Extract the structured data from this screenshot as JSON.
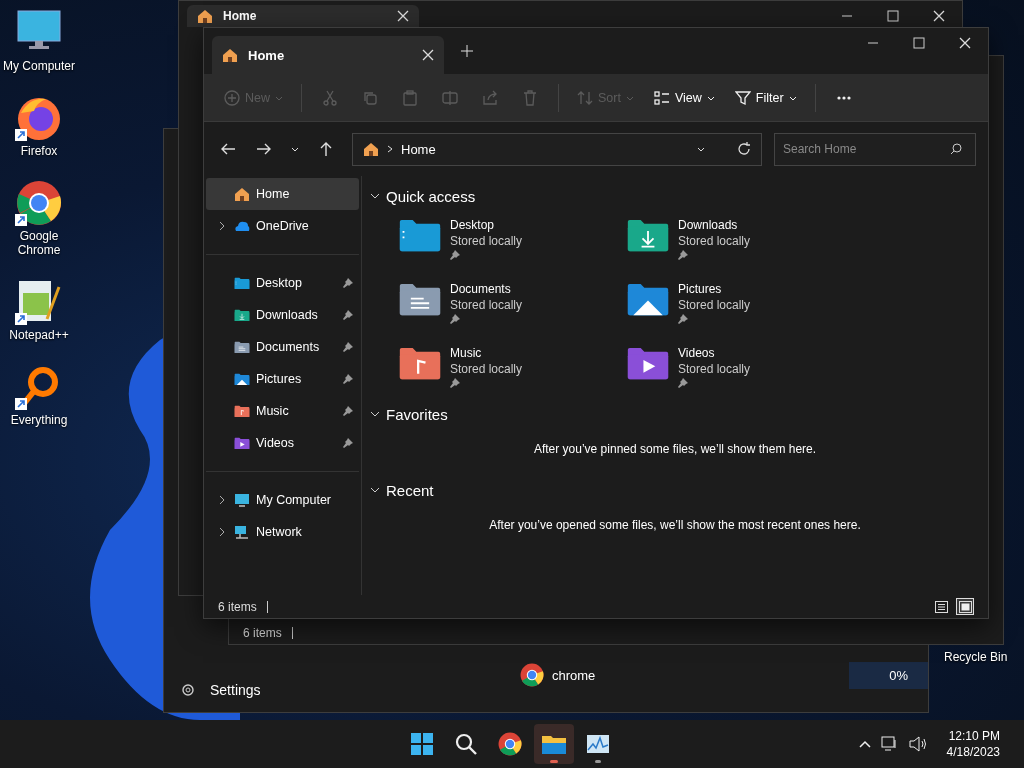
{
  "desktop_icons": [
    {
      "kind": "computer",
      "label": "My Computer",
      "shortcut": false
    },
    {
      "kind": "firefox",
      "label": "Firefox",
      "shortcut": true
    },
    {
      "kind": "chrome",
      "label": "Google Chrome",
      "shortcut": true
    },
    {
      "kind": "notepad",
      "label": "Notepad++",
      "shortcut": true
    },
    {
      "kind": "everything",
      "label": "Everything",
      "shortcut": true
    }
  ],
  "recycle_bin": {
    "label": "Recycle Bin"
  },
  "task_window": {
    "settings": "Settings",
    "processes": [
      {
        "name": "chrome",
        "value": "0%"
      }
    ]
  },
  "back_explorer": {
    "tab": "Home"
  },
  "second_explorer": {
    "status": "6 items"
  },
  "explorer": {
    "tab": {
      "label": "Home",
      "selected": true
    },
    "toolbar": [
      {
        "kind": "new",
        "label": "New",
        "disabled": true
      },
      {
        "kind": "cut",
        "disabled": true
      },
      {
        "kind": "copy",
        "disabled": true
      },
      {
        "kind": "paste",
        "disabled": true
      },
      {
        "kind": "rename",
        "disabled": true
      },
      {
        "kind": "share",
        "disabled": true
      },
      {
        "kind": "delete",
        "disabled": true
      },
      {
        "kind": "sort",
        "label": "Sort",
        "disabled": true
      },
      {
        "kind": "view",
        "label": "View",
        "disabled": false
      },
      {
        "kind": "filter",
        "label": "Filter",
        "disabled": false
      },
      {
        "kind": "more",
        "disabled": false
      }
    ],
    "address": "Home",
    "search": {
      "placeholder": "Search Home"
    },
    "sidebar": {
      "groups": [
        {
          "items": [
            {
              "kind": "home",
              "label": "Home",
              "selected": true,
              "expandable": false,
              "pinned": false
            },
            {
              "kind": "onedrive",
              "label": "OneDrive",
              "selected": false,
              "expandable": true,
              "pinned": false
            }
          ]
        },
        {
          "items": [
            {
              "kind": "desktop",
              "label": "Desktop",
              "selected": false,
              "expandable": false,
              "pinned": true
            },
            {
              "kind": "downloads",
              "label": "Downloads",
              "selected": false,
              "expandable": false,
              "pinned": true
            },
            {
              "kind": "documents",
              "label": "Documents",
              "selected": false,
              "expandable": false,
              "pinned": true
            },
            {
              "kind": "pictures",
              "label": "Pictures",
              "selected": false,
              "expandable": false,
              "pinned": true
            },
            {
              "kind": "music",
              "label": "Music",
              "selected": false,
              "expandable": false,
              "pinned": true
            },
            {
              "kind": "videos",
              "label": "Videos",
              "selected": false,
              "expandable": false,
              "pinned": true
            }
          ]
        },
        {
          "items": [
            {
              "kind": "computer",
              "label": "My Computer",
              "selected": false,
              "expandable": true,
              "pinned": false
            },
            {
              "kind": "network",
              "label": "Network",
              "selected": false,
              "expandable": true,
              "pinned": false
            }
          ]
        }
      ]
    },
    "sections": [
      {
        "title": "Quick access",
        "expanded": true,
        "items": [
          {
            "kind": "desktop",
            "name": "Desktop",
            "status": "Stored locally",
            "pinned": true
          },
          {
            "kind": "downloads",
            "name": "Downloads",
            "status": "Stored locally",
            "pinned": true
          },
          {
            "kind": "documents",
            "name": "Documents",
            "status": "Stored locally",
            "pinned": true
          },
          {
            "kind": "pictures",
            "name": "Pictures",
            "status": "Stored locally",
            "pinned": true
          },
          {
            "kind": "music",
            "name": "Music",
            "status": "Stored locally",
            "pinned": true
          },
          {
            "kind": "videos",
            "name": "Videos",
            "status": "Stored locally",
            "pinned": true
          }
        ]
      },
      {
        "title": "Favorites",
        "expanded": true,
        "message": "After you’ve pinned some files, we’ll show them here."
      },
      {
        "title": "Recent",
        "expanded": true,
        "message": "After you’ve opened some files, we’ll show the most recent ones here."
      }
    ],
    "status": "6 items",
    "view_modes": [
      {
        "kind": "details",
        "selected": false
      },
      {
        "kind": "tiles",
        "selected": true
      }
    ]
  },
  "taskbar": {
    "apps": [
      {
        "kind": "start",
        "running": false,
        "active": false
      },
      {
        "kind": "search",
        "running": false,
        "active": false
      },
      {
        "kind": "chrome",
        "running": false,
        "active": false
      },
      {
        "kind": "explorer",
        "running": true,
        "active": true
      },
      {
        "kind": "taskmgr",
        "running": true,
        "active": false
      }
    ],
    "time": "12:10 PM",
    "date": "4/18/2023"
  }
}
